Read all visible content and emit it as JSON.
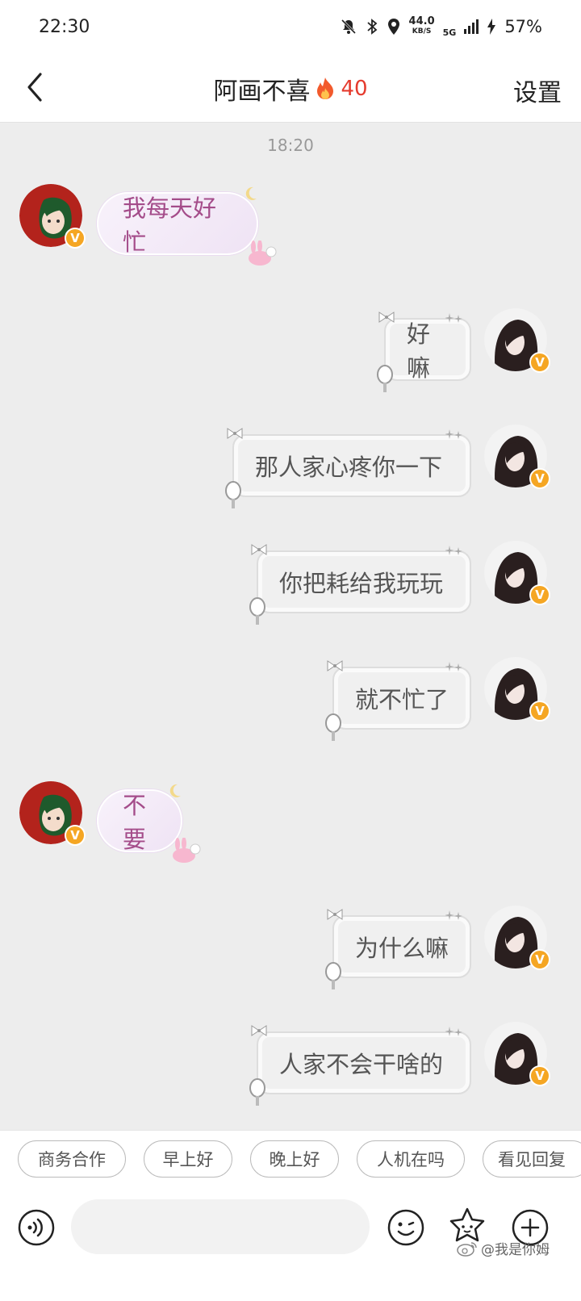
{
  "status_bar": {
    "time": "22:30",
    "net_speed_value": "44.0",
    "net_speed_unit": "KB/S",
    "network": "5G",
    "battery": "57%"
  },
  "header": {
    "title": "阿画不喜",
    "fire_count": "40",
    "settings_label": "设置"
  },
  "chat": {
    "timestamp": "18:20",
    "messages": [
      {
        "side": "left",
        "text": "我每天好忙"
      },
      {
        "side": "right",
        "text": "好嘛"
      },
      {
        "side": "right",
        "text": "那人家心疼你一下"
      },
      {
        "side": "right",
        "text": "你把耗给我玩玩"
      },
      {
        "side": "right",
        "text": "就不忙了"
      },
      {
        "side": "left",
        "text": "不要"
      },
      {
        "side": "right",
        "text": "为什么嘛"
      },
      {
        "side": "right",
        "text": "人家不会干啥的"
      }
    ]
  },
  "quick_replies": [
    "商务合作",
    "早上好",
    "晚上好",
    "人机在吗",
    "看见回复"
  ],
  "input": {
    "placeholder": ""
  },
  "watermark": "@我是你姆",
  "colors": {
    "accent_red": "#e53b2e",
    "badge_orange": "#f5a623",
    "left_text": "#a44c8a"
  }
}
